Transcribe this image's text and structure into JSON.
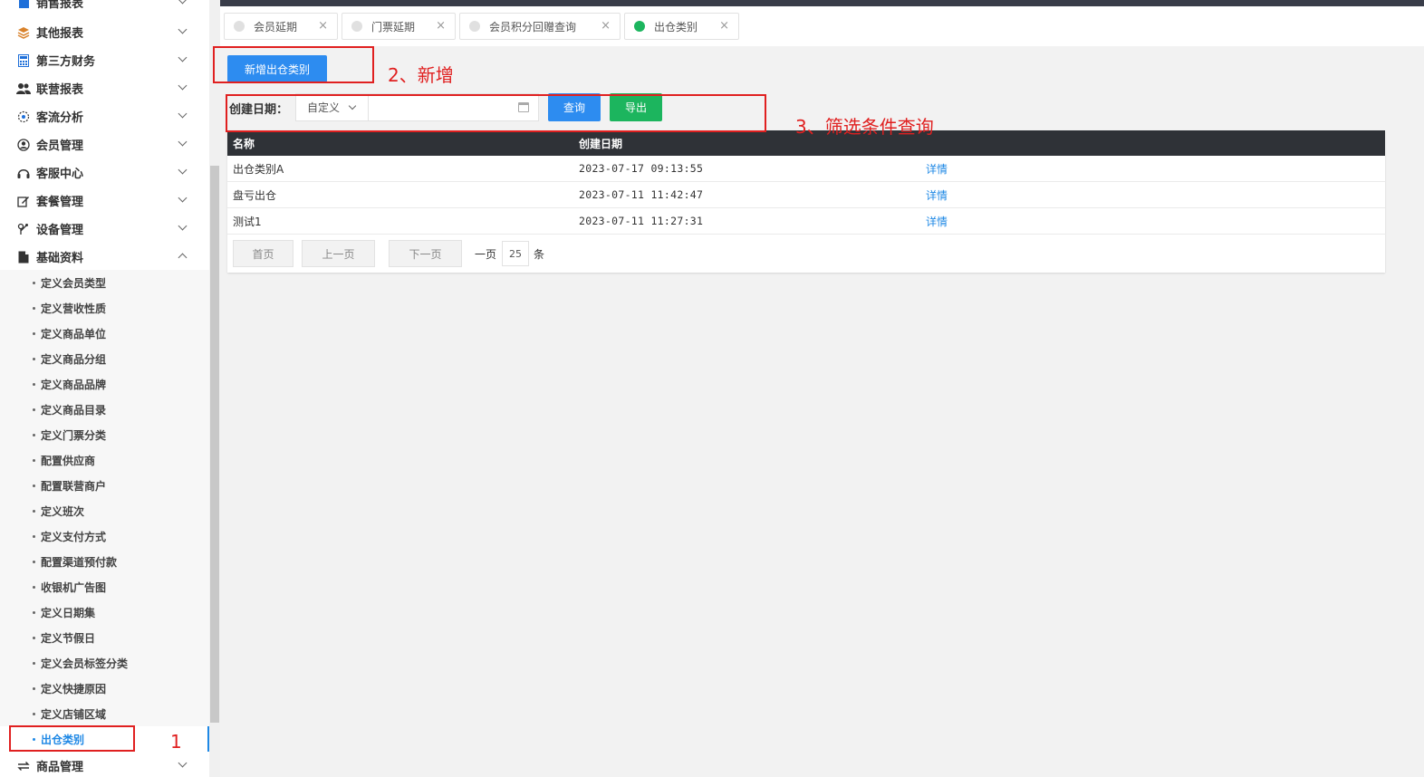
{
  "sidebar": {
    "partial_top_label": "销售报表",
    "items": [
      {
        "label": "其他报表",
        "icon": "layers-icon"
      },
      {
        "label": "第三方财务",
        "icon": "calculator-icon"
      },
      {
        "label": "联营报表",
        "icon": "users-icon"
      },
      {
        "label": "客流分析",
        "icon": "target-icon"
      },
      {
        "label": "会员管理",
        "icon": "user-icon"
      },
      {
        "label": "客服中心",
        "icon": "headset-icon"
      },
      {
        "label": "套餐管理",
        "icon": "edit-icon"
      },
      {
        "label": "设备管理",
        "icon": "device-icon"
      },
      {
        "label": "基础资料",
        "icon": "file-icon"
      }
    ],
    "sub_items": [
      "定义会员类型",
      "定义营收性质",
      "定义商品单位",
      "定义商品分组",
      "定义商品品牌",
      "定义商品目录",
      "定义门票分类",
      "配置供应商",
      "配置联营商户",
      "定义班次",
      "定义支付方式",
      "配置渠道预付款",
      "收银机广告图",
      "定义日期集",
      "定义节假日",
      "定义会员标签分类",
      "定义快捷原因",
      "定义店铺区域",
      "出仓类别"
    ],
    "bottom_item": {
      "label": "商品管理",
      "icon": "swap-icon"
    }
  },
  "tabs": [
    {
      "label": "会员延期",
      "active": false
    },
    {
      "label": "门票延期",
      "active": false
    },
    {
      "label": "会员积分回赠查询",
      "active": false
    },
    {
      "label": "出仓类别",
      "active": true
    }
  ],
  "toolbar": {
    "add_label": "新增出仓类别"
  },
  "filter": {
    "label": "创建日期：",
    "select_value": "自定义",
    "date_value": "",
    "query_label": "查询",
    "export_label": "导出"
  },
  "table": {
    "columns": [
      "名称",
      "创建日期"
    ],
    "rows": [
      {
        "name": "出仓类别A",
        "date": "2023-07-17 09:13:55",
        "action": "详情"
      },
      {
        "name": "盘亏出仓",
        "date": "2023-07-11 11:42:47",
        "action": "详情"
      },
      {
        "name": "测试1",
        "date": "2023-07-11 11:27:31",
        "action": "详情"
      }
    ]
  },
  "pagination": {
    "first": "首页",
    "prev": "上一页",
    "next": "下一页",
    "per_page_prefix": "一页",
    "per_page": "25",
    "per_page_suffix": "条"
  },
  "annotations": {
    "step1": "1",
    "step2": "2、新增",
    "step3": "3、筛选条件查询"
  },
  "colors": {
    "primary": "#2d8cf0",
    "success": "#1cb55e",
    "annotation": "#e02020",
    "table_header": "#2f3237"
  }
}
